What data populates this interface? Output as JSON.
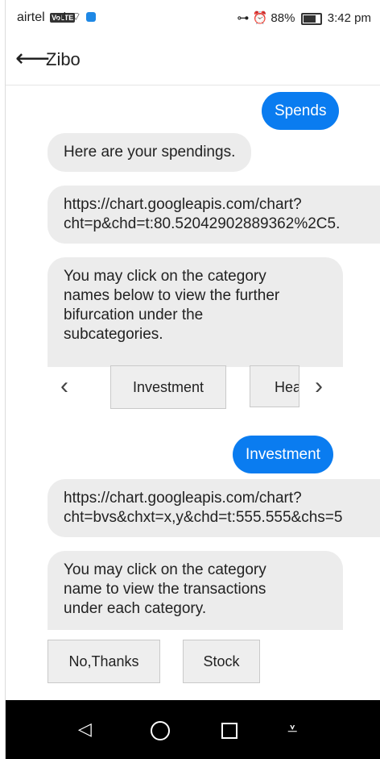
{
  "status_bar": {
    "carrier": "airtel",
    "carrier_badge": "VoLTE",
    "signal_glyphs": ".ıl ⌔",
    "key_glyph": "⊶",
    "alarm_glyph": "⏰",
    "battery_percent": "88%",
    "time": "3:42 pm"
  },
  "app_bar": {
    "back_glyph": "⟵",
    "title": "Zibo"
  },
  "chat": {
    "msg_spends": "Spends",
    "msg_spendings": "Here are your spendings.",
    "msg_link1_line1": "https://chart.googleapis.com/chart?",
    "msg_link1_line2": "cht=p&chd=t:80.52042902889362%2C5.",
    "msg_click1_line1": "You may click on the category",
    "msg_click1_line2": "names below to view the further",
    "msg_click1_line3": "bifurcation under the",
    "msg_click1_line4": "subcategories.",
    "carousel_prev": "‹",
    "carousel_next": "›",
    "carousel_item1": "Investment",
    "carousel_item2": "Heal",
    "msg_investment": "Investment",
    "msg_link2_line1": "https://chart.googleapis.com/chart?",
    "msg_link2_line2": "cht=bvs&chxt=x,y&chd=t:555.555&chs=5",
    "msg_click2_line1": "You may click on the category",
    "msg_click2_line2": "name to view the transactions",
    "msg_click2_line3": "under each category.",
    "reply_no_thanks": "No,Thanks",
    "reply_stock": "Stock"
  },
  "nav_bar": {
    "back_glyph": "◁",
    "menu_glyph": "⩡"
  },
  "colors": {
    "accent": "#0a7cf0",
    "bot_bubble": "#ececec",
    "nav_bar": "#000000"
  }
}
